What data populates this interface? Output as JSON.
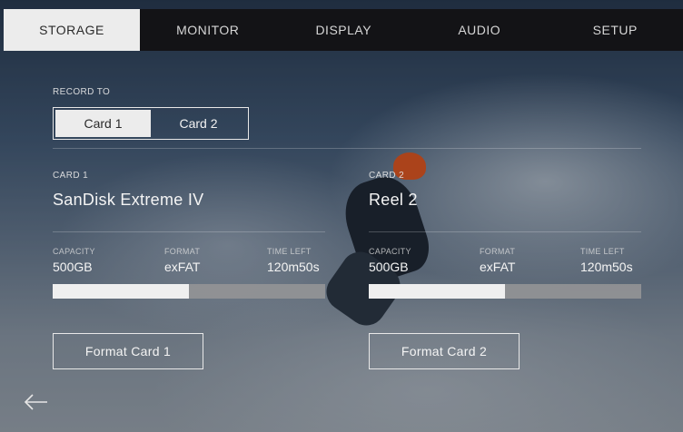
{
  "tabs": [
    {
      "label": "STORAGE",
      "active": true
    },
    {
      "label": "MONITOR"
    },
    {
      "label": "DISPLAY"
    },
    {
      "label": "AUDIO"
    },
    {
      "label": "SETUP"
    }
  ],
  "record_to": {
    "label": "RECORD TO",
    "options": [
      "Card 1",
      "Card 2"
    ],
    "selected": "Card 1"
  },
  "cards": [
    {
      "slot_label": "CARD 1",
      "name": "SanDisk Extreme IV",
      "capacity_label": "CAPACITY",
      "capacity": "500GB",
      "format_label": "FORMAT",
      "format": "exFAT",
      "time_left_label": "TIME LEFT",
      "time_left": "120m50s",
      "fill_fraction": 0.5,
      "format_button": "Format Card 1"
    },
    {
      "slot_label": "CARD 2",
      "name": "Reel 2",
      "capacity_label": "CAPACITY",
      "capacity": "500GB",
      "format_label": "FORMAT",
      "format": "exFAT",
      "time_left_label": "TIME LEFT",
      "time_left": "120m50s",
      "fill_fraction": 0.5,
      "format_button": "Format Card 2"
    }
  ],
  "back_icon": "back-arrow-icon",
  "colors": {
    "tab_bar": "#131316",
    "active_tab": "#ececec",
    "bar_fill": "#efefef",
    "bar_track": "#969698"
  }
}
